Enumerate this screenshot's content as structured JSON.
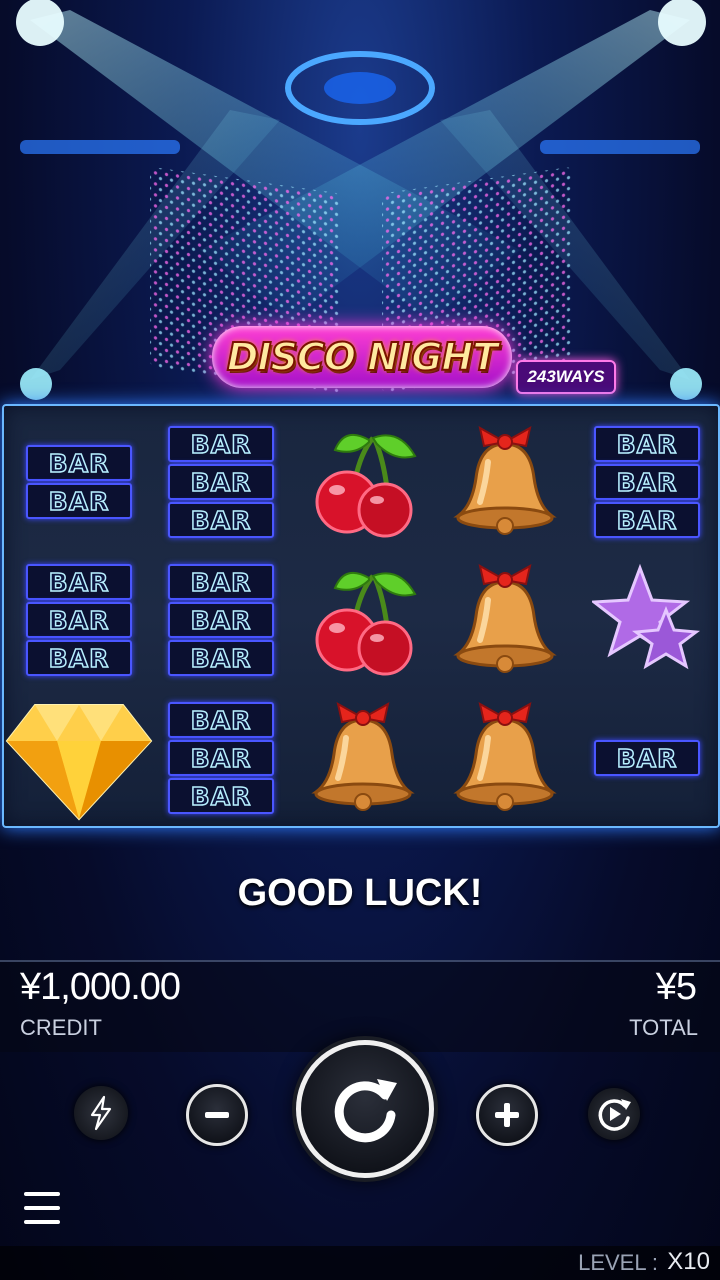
{
  "game": {
    "logo_text": "DISCO NIGHT",
    "ways_badge": "243WAYS"
  },
  "reels": [
    {
      "reel": 1,
      "symbols": [
        "bar-double",
        "bar-triple",
        "diamond"
      ]
    },
    {
      "reel": 2,
      "symbols": [
        "bar-triple",
        "bar-triple",
        "bar-triple"
      ]
    },
    {
      "reel": 3,
      "symbols": [
        "cherry",
        "cherry",
        "bell"
      ]
    },
    {
      "reel": 4,
      "symbols": [
        "bell",
        "bell",
        "bell"
      ]
    },
    {
      "reel": 5,
      "symbols": [
        "bar-triple",
        "star",
        "bar-single"
      ]
    }
  ],
  "bar_text": "BAR",
  "message": "GOOD LUCK!",
  "credit": {
    "value": "¥1,000.00",
    "label": "CREDIT"
  },
  "total": {
    "value": "¥5",
    "label": "TOTAL"
  },
  "controls": {
    "turbo_icon": "lightning-icon",
    "minus_icon": "minus-icon",
    "spin_icon": "spin-arrow-icon",
    "plus_icon": "plus-icon",
    "autoplay_icon": "autoplay-icon",
    "menu_icon": "hamburger-menu-icon"
  },
  "level": {
    "label": "LEVEL :",
    "value": "X10"
  },
  "colors": {
    "accent_pink": "#ff3fd2",
    "bar_border": "#4a56ff",
    "frame_glow": "#6bb8ff"
  }
}
